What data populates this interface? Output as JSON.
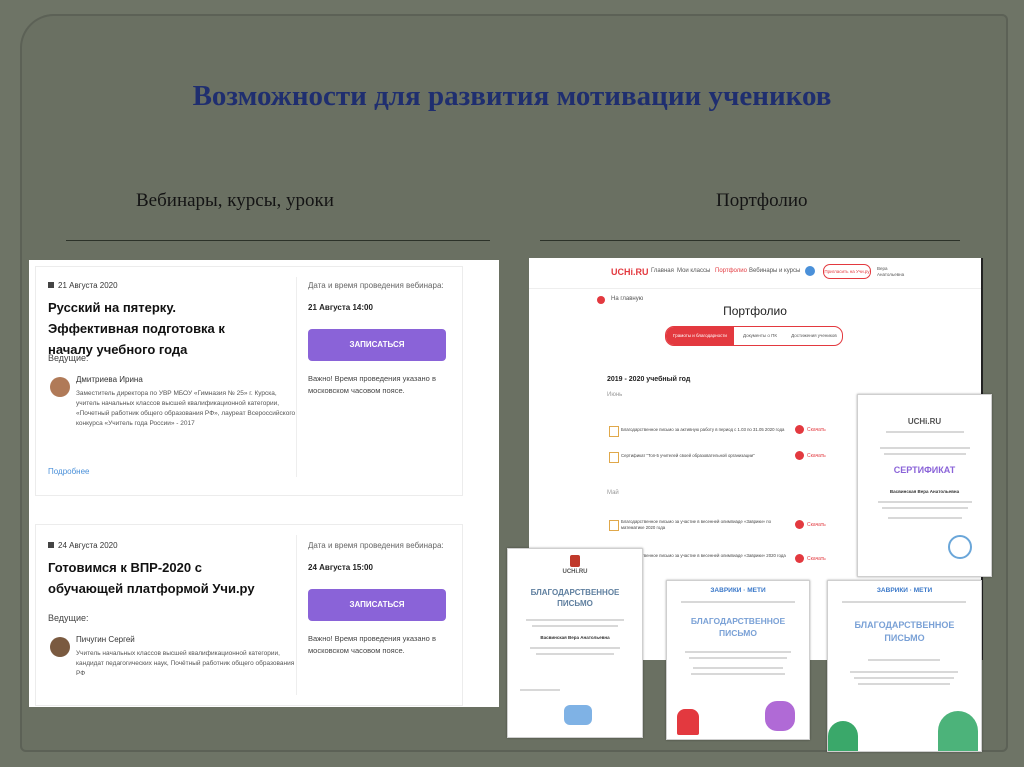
{
  "slide": {
    "title": "Возможности для развития мотивации учеников",
    "left_heading": "Вебинары, курсы, уроки",
    "right_heading": "Портфолио"
  },
  "webinars": [
    {
      "date": "21 Августа 2020",
      "title": "Русский на пятерку. Эффективная подготовка к началу учебного года",
      "host_label": "Ведущие:",
      "host_name": "Дмитриева Ирина",
      "host_bio": "Заместитель директора по УВР МБОУ «Гимназия № 25» г. Курска, учитель начальных классов высшей квалификационной категории, «Почетный работник общего образования РФ», лауреат Всероссийского конкурса «Учитель года России» - 2017",
      "more_link": "Подробнее",
      "time_label": "Дата и время проведения вебинара:",
      "time_value": "21 Августа 14:00",
      "button": "ЗАПИСАТЬСЯ",
      "note": "Важно! Время проведения указано в московском часовом поясе."
    },
    {
      "date": "24 Августа 2020",
      "title": "Готовимся к ВПР-2020 с обучающей платформой Учи.ру",
      "host_label": "Ведущие:",
      "host_name": "Пичугин Сергей",
      "host_bio": "Учитель начальных классов высшей квалификационной категории, кандидат педагогических наук, Почётный работник общего образования РФ",
      "time_label": "Дата и время проведения вебинара:",
      "time_value": "24 Августа 15:00",
      "button": "ЗАПИСАТЬСЯ",
      "note": "Важно! Время проведения указано в московском часовом поясе."
    }
  ],
  "portfolio": {
    "logo": "UCHi.RU",
    "nav": [
      "Главная",
      "Мои классы",
      "Портфолио",
      "Вебинары и курсы"
    ],
    "invite_button": "Пригласить на Учи.ру",
    "user": "Вера Анатольевна",
    "back": "На главную",
    "page_title": "Портфолио",
    "tabs": [
      "Грамоты и благодарности",
      "Документы о ПК",
      "Достижения учеников"
    ],
    "year": "2019 - 2020 учебный год",
    "months": [
      "Июнь",
      "Май"
    ],
    "items": [
      {
        "text": "Благодарственное письмо за активную работу в период с 1.03 по 31.05 2020 года",
        "action": "Скачать"
      },
      {
        "text": "Сертификат \"Топ-5 учителей своей образовательной организации\"",
        "action": "Скачать"
      },
      {
        "text": "Благодарственное письмо за участие в весенней олимпиаде «Заврики» по математике 2020 года",
        "action": "Скачать"
      },
      {
        "text": "Благодарственное письмо за участие в весенней олимпиаде «Заврики» 2020 года",
        "action": "Скачать"
      }
    ]
  },
  "documents": {
    "certificate": {
      "logo": "UCHi.RU",
      "title": "СЕРТИФИКАТ",
      "name": "Васвинская Вера Анатольевна"
    },
    "letter1": {
      "logo": "UCHi.RU",
      "title": "БЛАГОДАРСТВЕННОЕ ПИСЬМО",
      "name": "Васвинская Вера Анатольевна"
    },
    "letter2": {
      "brand": "ЗАВРИКИ · МЕТИ",
      "title": "БЛАГОДАРСТВЕННОЕ ПИСЬМО"
    },
    "letter3": {
      "brand": "ЗАВРИКИ · МЕТИ",
      "title": "БЛАГОДАРСТВЕННОЕ ПИСЬМО"
    }
  },
  "colors": {
    "accent_purple": "#8a63d8",
    "uchi_red": "#e3393f",
    "title_blue": "#1f2e6f"
  }
}
